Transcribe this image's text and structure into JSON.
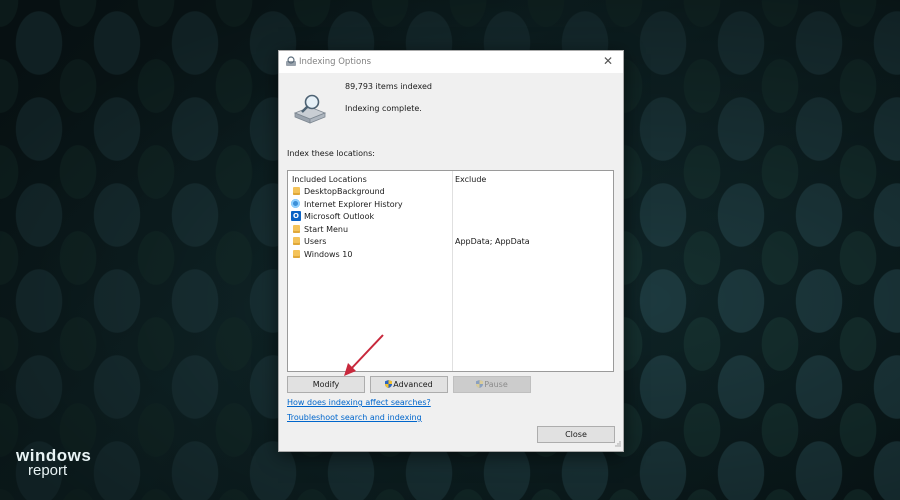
{
  "window": {
    "title": "Indexing Options",
    "close_glyph": "✕"
  },
  "status": {
    "items_indexed": "89,793 items indexed",
    "state": "Indexing complete."
  },
  "locations": {
    "label": "Index these locations:",
    "columns": {
      "included": "Included Locations",
      "exclude": "Exclude"
    },
    "items": [
      {
        "name": "DesktopBackground",
        "exclude": "",
        "icon": "folder-icon"
      },
      {
        "name": "Internet Explorer History",
        "exclude": "",
        "icon": "internet-explorer-icon"
      },
      {
        "name": "Microsoft Outlook",
        "exclude": "",
        "icon": "outlook-icon",
        "icon_glyph": "O"
      },
      {
        "name": "Start Menu",
        "exclude": "",
        "icon": "folder-icon"
      },
      {
        "name": "Users",
        "exclude": "AppData; AppData",
        "icon": "folder-icon"
      },
      {
        "name": "Windows 10",
        "exclude": "",
        "icon": "folder-icon"
      }
    ]
  },
  "buttons": {
    "modify": "Modify",
    "advanced": "Advanced",
    "pause": "Pause",
    "close": "Close"
  },
  "links": {
    "affect_searches": "How does indexing affect searches?",
    "troubleshoot": "Troubleshoot search and indexing"
  },
  "branding": {
    "line1": "windows",
    "line2": "report"
  },
  "colors": {
    "link": "#0066cc",
    "annotation_arrow": "#c8283c",
    "folder": "#f4c35a"
  }
}
